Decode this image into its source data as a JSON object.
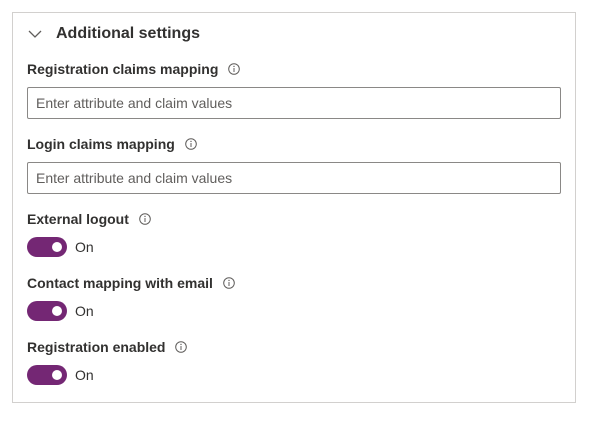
{
  "section": {
    "title": "Additional settings",
    "expanded": true,
    "icon": "chevron-down-icon"
  },
  "registration_claims": {
    "label": "Registration claims mapping",
    "placeholder": "Enter attribute and claim values",
    "value": "",
    "info_icon": "info-icon"
  },
  "login_claims": {
    "label": "Login claims mapping",
    "placeholder": "Enter attribute and claim values",
    "value": "",
    "info_icon": "info-icon"
  },
  "external_logout": {
    "label": "External logout",
    "state_label": "On",
    "checked": true,
    "info_icon": "info-icon"
  },
  "contact_mapping": {
    "label": "Contact mapping with email",
    "state_label": "On",
    "checked": true,
    "info_icon": "info-icon"
  },
  "registration_enabled": {
    "label": "Registration enabled",
    "state_label": "On",
    "checked": true,
    "info_icon": "info-icon"
  },
  "colors": {
    "toggle_on": "#742774",
    "border": "#d2d0ce",
    "input_border": "#8a8886",
    "text": "#323130"
  }
}
